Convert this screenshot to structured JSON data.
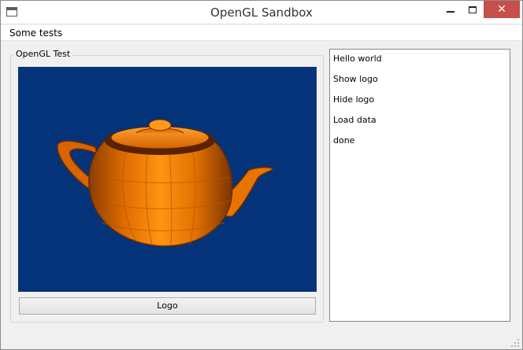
{
  "window": {
    "title": "OpenGL Sandbox",
    "close_glyph": "✕"
  },
  "menu": {
    "items": [
      {
        "label": "Some tests"
      }
    ]
  },
  "group": {
    "title": "OpenGL Test"
  },
  "viewport": {
    "background_color": "#05337a",
    "object": "teapot",
    "object_color": "#ff8a00"
  },
  "buttons": {
    "logo_label": "Logo"
  },
  "log_list": {
    "items": [
      "Hello world",
      "Show logo",
      "Hide logo",
      "Load data",
      "done"
    ]
  }
}
